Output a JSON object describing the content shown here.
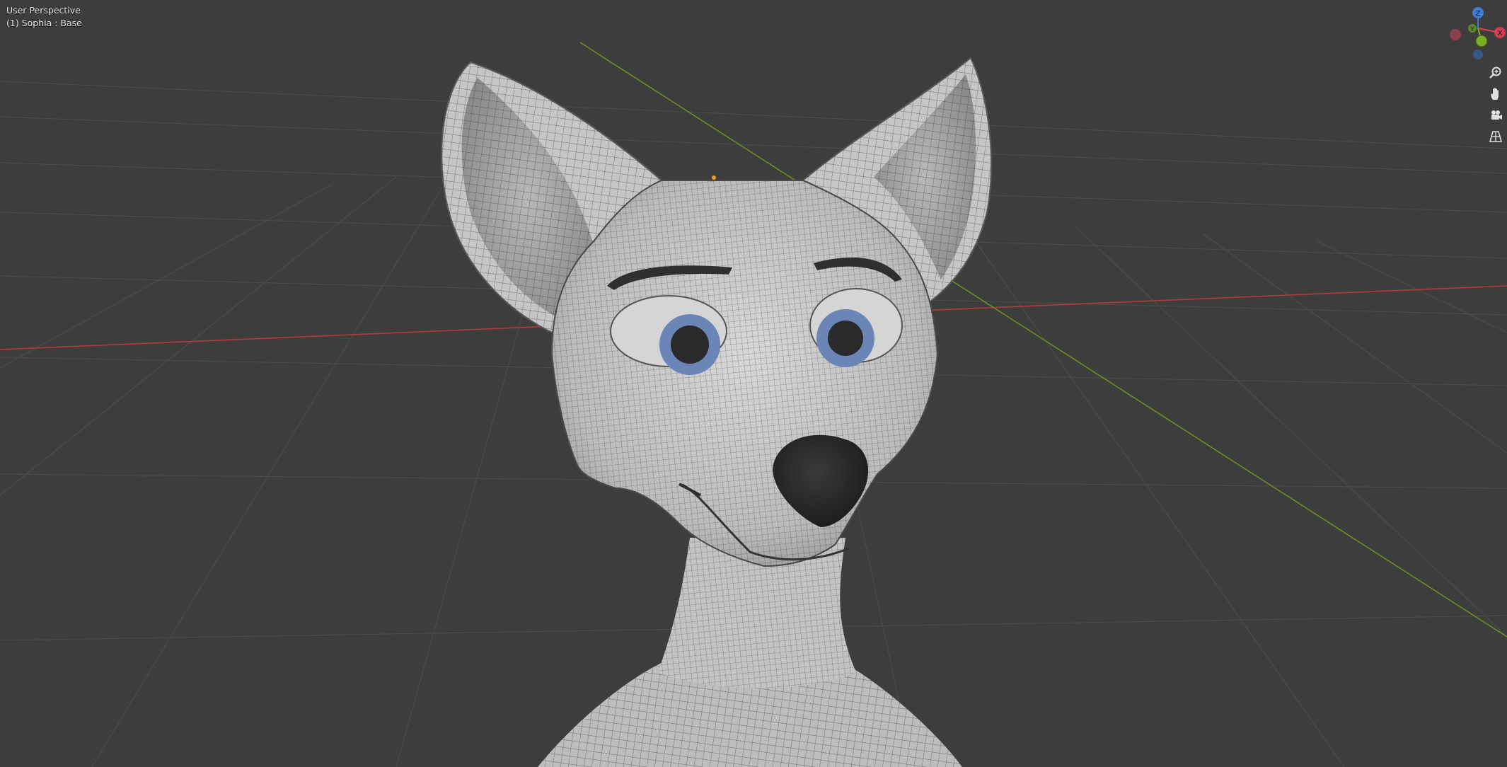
{
  "viewport": {
    "view_name": "User Perspective",
    "object_name": "(1) Sophia : Base"
  },
  "gizmo": {
    "axis_z_label": "Z",
    "axis_y_label": "Y",
    "axis_x_label": "X",
    "colors": {
      "x": "#e03e54",
      "y": "#78ad24",
      "z": "#3b7dd7"
    }
  },
  "nav_buttons": [
    {
      "icon": "zoom-icon"
    },
    {
      "icon": "hand-pan-icon"
    },
    {
      "icon": "camera-icon"
    },
    {
      "icon": "grid-perspective-icon"
    }
  ],
  "colors": {
    "background": "#3d3d3d",
    "grid_line": "#4a4a4a",
    "x_axis_line": "#b83a3a",
    "y_axis_line": "#6b8e23",
    "mesh_base": "#c8c8c8",
    "mesh_wire": "#2a2a2a",
    "iris": "#6b86b6",
    "pupil": "#2a2a2a",
    "nose": "#2b2b2b"
  }
}
